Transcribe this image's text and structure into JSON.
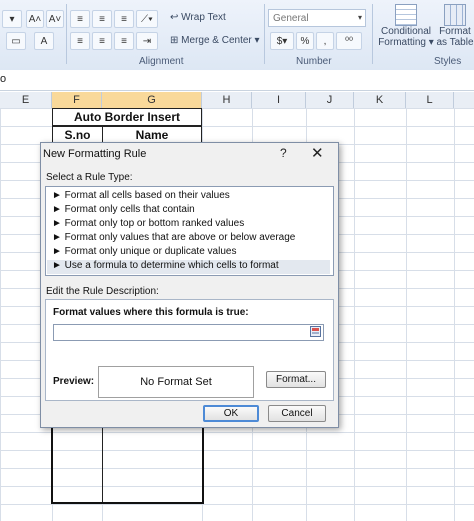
{
  "ribbon": {
    "font_size_buttons": [
      "A˄",
      "A˅"
    ],
    "wrap_text": "Wrap Text",
    "merge_center": "Merge & Center",
    "number_format": "General",
    "number_buttons": [
      "%",
      ",",
      "⁰⁰"
    ],
    "conditional_formatting": [
      "Conditional",
      "Formatting"
    ],
    "format_as_table": [
      "Format",
      "as Table"
    ],
    "groups": [
      "Alignment",
      "Number",
      "Styles"
    ]
  },
  "formula_bar": {
    "name_box": "o"
  },
  "columns": [
    "E",
    "F",
    "G",
    "H",
    "I",
    "J",
    "K",
    "L"
  ],
  "sheet": {
    "title": "Auto Border Insert",
    "headers": [
      "S.no",
      "Name"
    ]
  },
  "dialog": {
    "title": "New Formatting Rule",
    "help": "?",
    "close": "✕",
    "select_type_label": "Select a Rule Type:",
    "rule_types": [
      "► Format all cells based on their values",
      "► Format only cells that contain",
      "► Format only top or bottom ranked values",
      "► Format only values that are above or below average",
      "► Format only unique or duplicate values",
      "► Use a formula to determine which cells to format"
    ],
    "edit_label": "Edit the Rule Description:",
    "formula_label": "Format values where this formula is true:",
    "formula_value": "",
    "preview_label": "Preview:",
    "preview_text": "No Format Set",
    "format_button": "Format...",
    "ok": "OK",
    "cancel": "Cancel"
  }
}
